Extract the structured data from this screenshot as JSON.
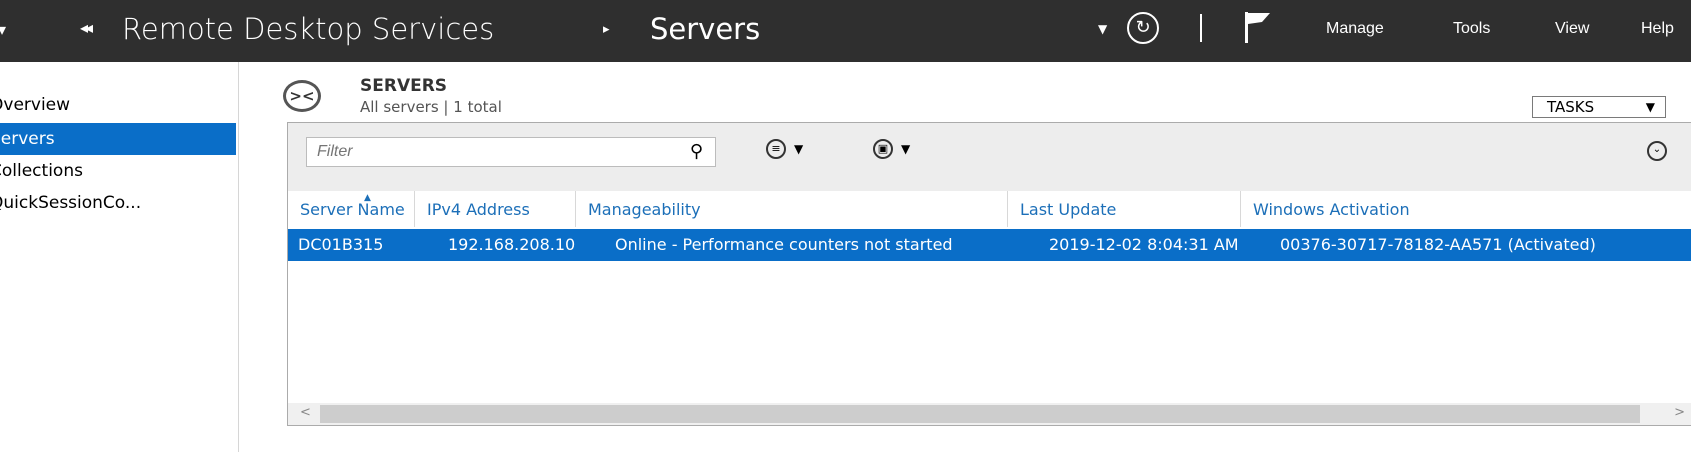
{
  "titlebar": {
    "back_glyph": "◂◂",
    "crumb_root": "Remote Desktop Services",
    "crumb_sep": "▸",
    "crumb_current": "Servers",
    "menu": [
      "Manage",
      "Tools",
      "View",
      "Help"
    ]
  },
  "nav": {
    "items": [
      {
        "label": "Overview"
      },
      {
        "label": "Servers"
      },
      {
        "label": "Collections"
      },
      {
        "label": "QuickSessionCo..."
      }
    ]
  },
  "header": {
    "title": "SERVERS",
    "subtitle": "All servers | 1 total",
    "tasks_label": "TASKS"
  },
  "toolbar": {
    "filter_placeholder": "Filter"
  },
  "table": {
    "columns": [
      "Server Name",
      "IPv4 Address",
      "Manageability",
      "Last Update",
      "Windows Activation"
    ],
    "rows": [
      [
        "DC01B315",
        "192.168.208.10",
        "Online - Performance counters not started",
        "2019-12-02 8:04:31 AM",
        "00376-30717-78182-AA571 (Activated)"
      ]
    ]
  },
  "colors": {
    "titlebar_bg": "#2f2f2f",
    "selection": "#0a6ec8",
    "header_link": "#1c6fb8"
  }
}
